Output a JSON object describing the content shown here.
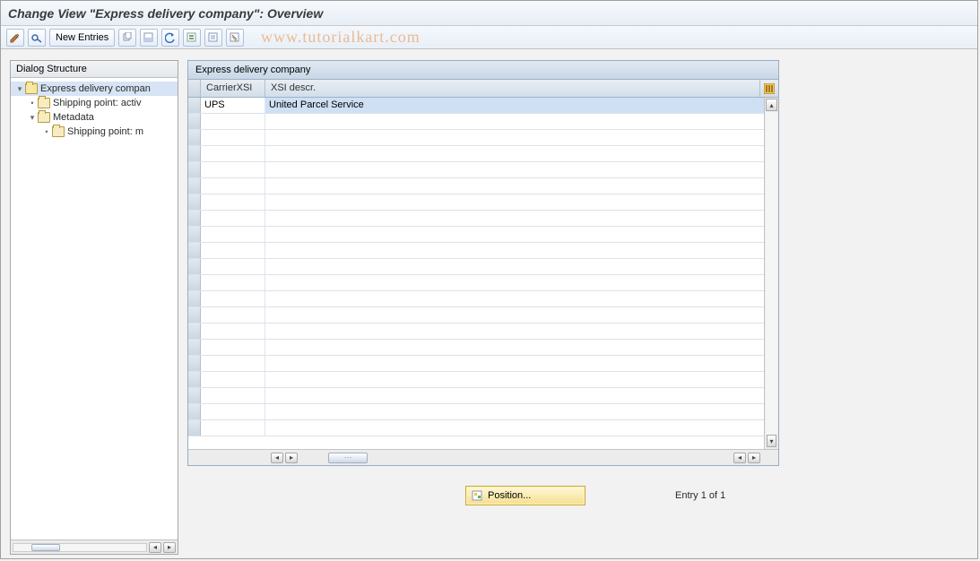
{
  "header": {
    "title": "Change View \"Express delivery company\": Overview"
  },
  "toolbar": {
    "new_entries": "New Entries"
  },
  "watermark": "www.tutorialkart.com",
  "tree": {
    "header": "Dialog Structure",
    "items": [
      {
        "label": "Express delivery compan"
      },
      {
        "label": "Shipping point: activ"
      },
      {
        "label": "Metadata"
      },
      {
        "label": "Shipping point: m"
      }
    ]
  },
  "grid": {
    "title": "Express delivery company",
    "columns": {
      "carrier": "CarrierXSI",
      "desc": "XSI descr."
    },
    "rows": [
      {
        "carrier": "UPS",
        "desc": "United Parcel Service"
      }
    ]
  },
  "footer": {
    "position_label": "Position...",
    "entry_text": "Entry 1 of 1"
  }
}
